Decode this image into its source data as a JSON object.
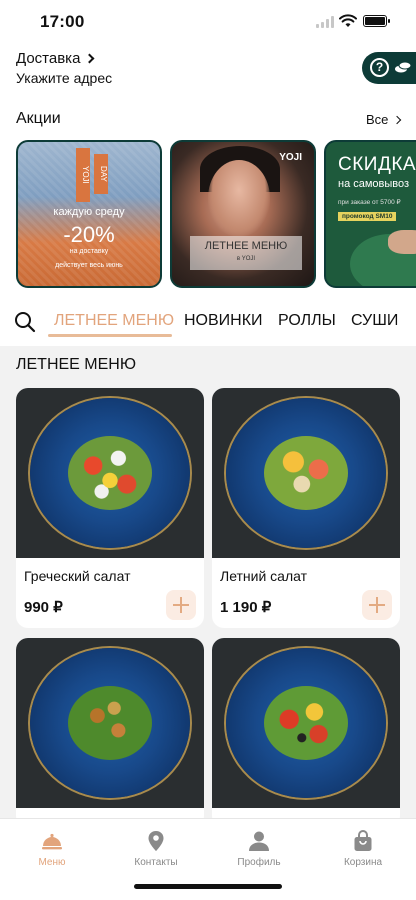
{
  "status_bar": {
    "time": "17:00"
  },
  "header": {
    "delivery_label": "Доставка",
    "address_placeholder": "Укажите адрес",
    "help_symbol": "?"
  },
  "promos": {
    "title": "Акции",
    "all_label": "Все",
    "cards": [
      {
        "tag1": "YOJI",
        "tag2": "DAY",
        "line1": "каждую среду",
        "line2": "-20%",
        "line3": "на доставку",
        "line4": "действует весь июнь"
      },
      {
        "brand": "YOJI",
        "title": "ЛЕТНЕЕ МЕНЮ",
        "subtitle": "в YOJI"
      },
      {
        "title": "СКИДКА",
        "subtitle": "на самовывоз",
        "condition": "при заказе от 5700 ₽",
        "code": "промокод SM10"
      }
    ]
  },
  "tabs": [
    "ЛЕТНЕЕ МЕНЮ",
    "НОВИНКИ",
    "РОЛЛЫ",
    "СУШИ"
  ],
  "active_tab": "ЛЕТНЕЕ МЕНЮ",
  "section_title": "ЛЕТНЕЕ МЕНЮ",
  "products": [
    {
      "name": "Греческий салат",
      "price": "990 ₽"
    },
    {
      "name": "Летний салат",
      "price": "1 190 ₽"
    }
  ],
  "nav": [
    {
      "label": "Меню",
      "icon": "cloche-icon",
      "active": true
    },
    {
      "label": "Контакты",
      "icon": "location-pin-icon",
      "active": false
    },
    {
      "label": "Профиль",
      "icon": "profile-icon",
      "active": false
    },
    {
      "label": "Корзина",
      "icon": "shopping-bag-icon",
      "active": false
    }
  ],
  "colors": {
    "accent": "#e2a47c",
    "brand_dark": "#0d3b37",
    "add_button_bg": "#fbece3",
    "plate_blue": "#1f5fa8"
  }
}
